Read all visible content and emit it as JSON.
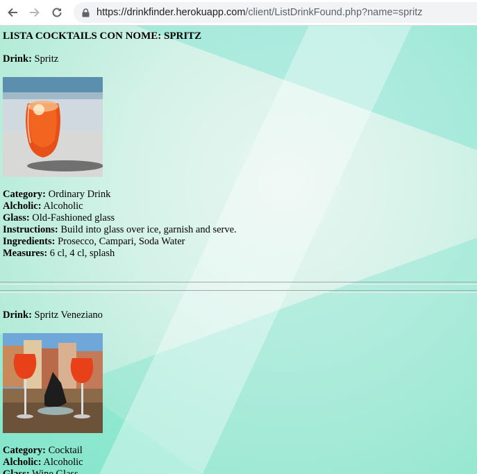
{
  "browser": {
    "url_host": "https://drinkfinder.herokuapp.com",
    "url_path": "/client/ListDrinkFound.php?name=spritz"
  },
  "page": {
    "heading": "LISTA COCKTAILS CON NOME: SPRITZ",
    "labels": {
      "drink": "Drink:",
      "category": "Category:",
      "alcholic": "Alcholic:",
      "glass": "Glass:",
      "instructions": "Instructions:",
      "ingredients": "Ingredients:",
      "measures": "Measures:"
    },
    "drinks": [
      {
        "name": "Spritz",
        "category": "Ordinary Drink",
        "alcholic": "Alcoholic",
        "glass": "Old-Fashioned glass",
        "instructions": "Build into glass over ice, garnish and serve.",
        "ingredients": "Prosecco, Campari, Soda Water",
        "measures": "6 cl, 4 cl, splash"
      },
      {
        "name": "Spritz Veneziano",
        "category": "Cocktail",
        "alcholic": "Alcoholic",
        "glass": "Wine Glass"
      }
    ]
  },
  "colors": {
    "spritz_orange": "#e8501a",
    "background_accent": "#9fe6cf"
  }
}
